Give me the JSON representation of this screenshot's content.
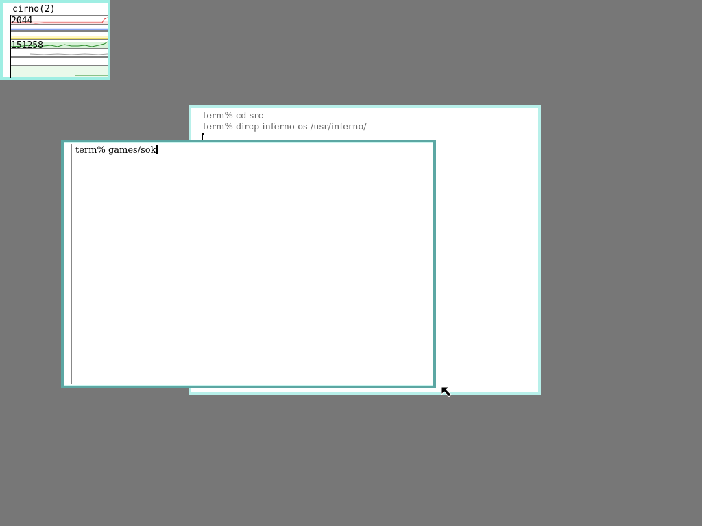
{
  "stats_window": {
    "title": "cirno(2)",
    "values": [
      "2044",
      "151258"
    ],
    "colors": {
      "red": "#e04040",
      "blue": "#3060e0",
      "yellow": "#d8c000",
      "green": "#2a8a2a",
      "gray": "#a0a0a0",
      "border": "#9feee3"
    }
  },
  "terminal_back": {
    "lines": [
      "term% cd src",
      "term% dircp inferno-os /usr/inferno/"
    ]
  },
  "terminal_front": {
    "lines": [
      "term% games/sok"
    ]
  },
  "icons": {
    "pointer": "arrow-pointer-icon"
  }
}
